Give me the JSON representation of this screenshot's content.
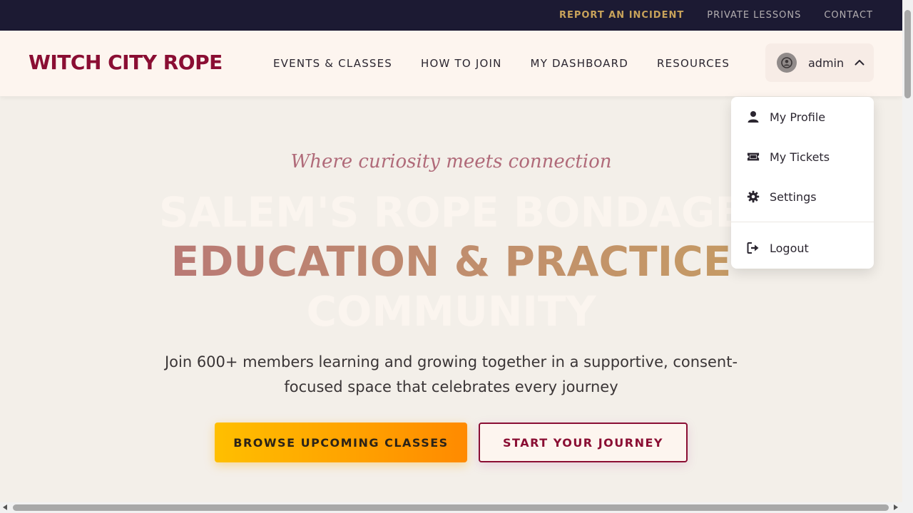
{
  "utility": {
    "report_incident": "REPORT AN INCIDENT",
    "private_lessons": "PRIVATE LESSONS",
    "contact": "CONTACT"
  },
  "header": {
    "logo": "WITCH CITY ROPE",
    "nav": {
      "events": "EVENTS & CLASSES",
      "how_to_join": "HOW TO JOIN",
      "dashboard": "MY DASHBOARD",
      "resources": "RESOURCES"
    },
    "user": {
      "name": "admin"
    }
  },
  "dropdown": {
    "profile": "My Profile",
    "tickets": "My Tickets",
    "settings": "Settings",
    "logout": "Logout"
  },
  "hero": {
    "tagline": "Where curiosity meets connection",
    "line1": "SALEM'S ROPE BONDAGE",
    "line2": "EDUCATION & PRACTICE",
    "line3": "COMMUNITY",
    "subtitle": "Join 600+ members learning and growing together in a supportive, consent-focused space that celebrates every journey",
    "primary_cta": "BROWSE UPCOMING CLASSES",
    "secondary_cta": "START YOUR JOURNEY"
  },
  "colors": {
    "brand": "#8a0e33",
    "accent_gold": "#c8a25a",
    "utility_bg": "#1c1a33",
    "header_bg": "#fdf5ef",
    "page_bg": "#f3efe9"
  },
  "icons": {
    "avatar": "user-circle-icon",
    "chevron": "chevron-up-icon",
    "profile": "user-icon",
    "tickets": "ticket-icon",
    "settings": "gear-icon",
    "logout": "logout-icon"
  }
}
